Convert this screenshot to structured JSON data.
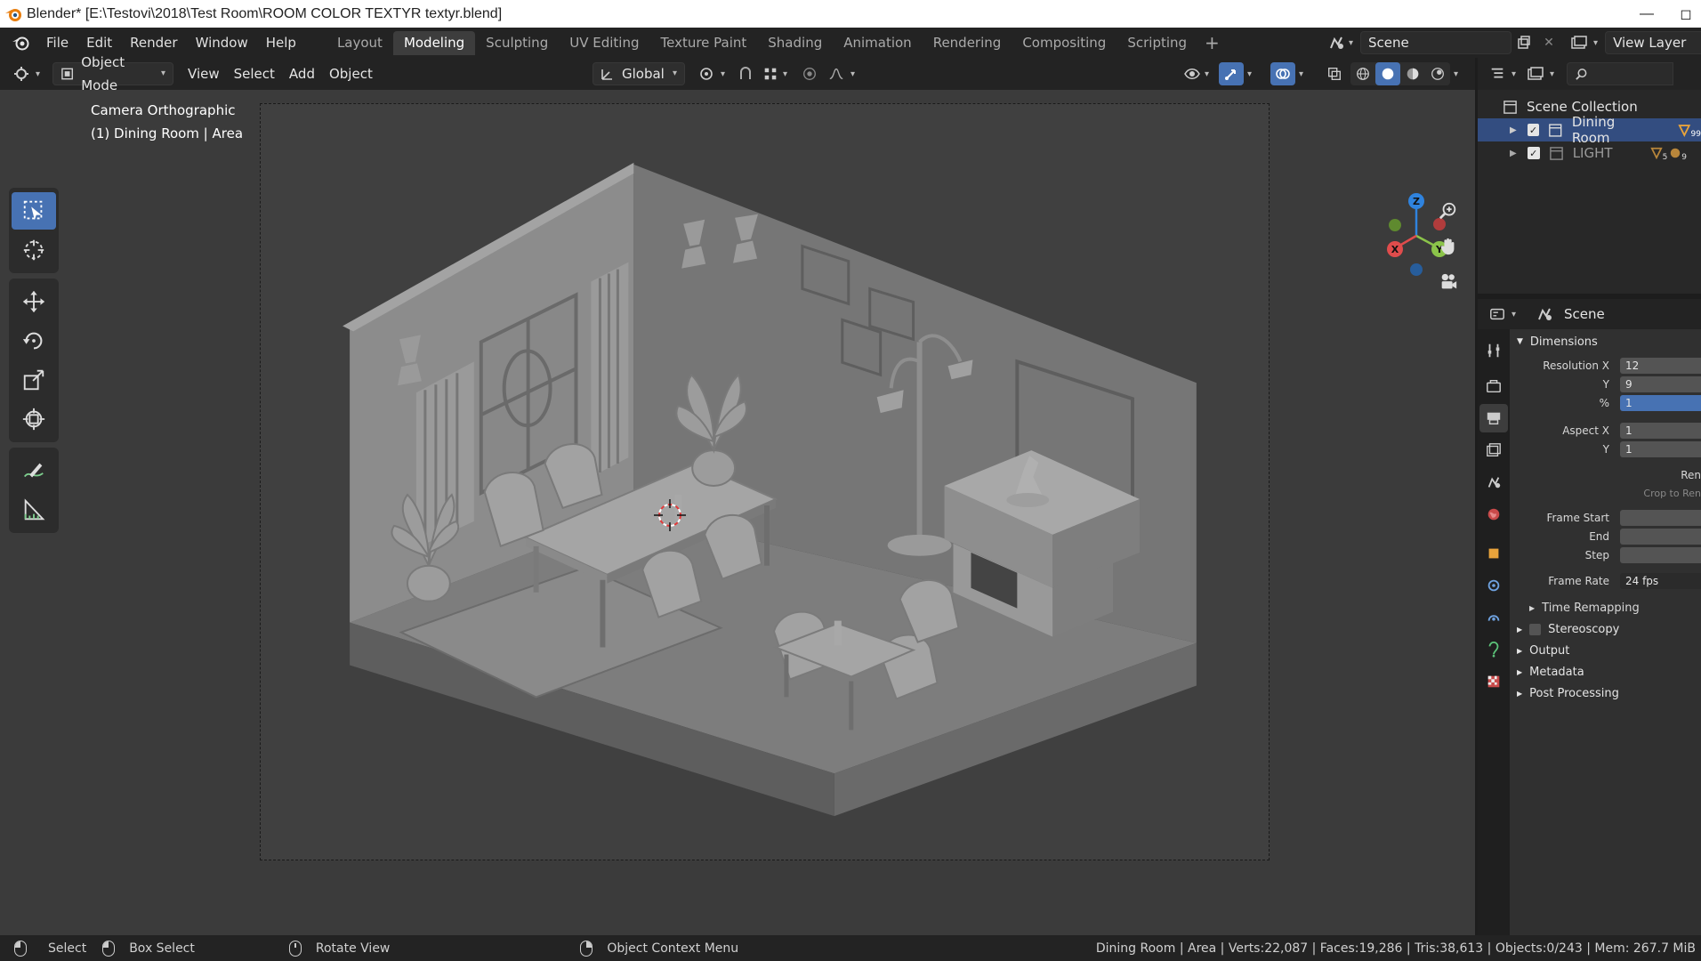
{
  "window": {
    "title": "Blender* [E:\\Testovi\\2018\\Test Room\\ROOM COLOR TEXTYR textyr.blend]",
    "controls": [
      "—",
      "◻"
    ]
  },
  "menu": [
    "File",
    "Edit",
    "Render",
    "Window",
    "Help"
  ],
  "workspaces": [
    {
      "label": "Layout",
      "active": false
    },
    {
      "label": "Modeling",
      "active": true
    },
    {
      "label": "Sculpting",
      "active": false
    },
    {
      "label": "UV Editing",
      "active": false
    },
    {
      "label": "Texture Paint",
      "active": false
    },
    {
      "label": "Shading",
      "active": false
    },
    {
      "label": "Animation",
      "active": false
    },
    {
      "label": "Rendering",
      "active": false
    },
    {
      "label": "Compositing",
      "active": false
    },
    {
      "label": "Scripting",
      "active": false
    }
  ],
  "workspace_add": "+",
  "scene_field": "Scene",
  "view_layer_field": "View Layer",
  "header": {
    "mode": "Object Mode",
    "view": "View",
    "select": "Select",
    "add": "Add",
    "object": "Object",
    "orientation": "Global"
  },
  "viewport": {
    "camera_label": "Camera Orthographic",
    "object_label": "(1) Dining Room | Area"
  },
  "gizmo": {
    "z": "Z",
    "y": "Y",
    "x": "X"
  },
  "outliner": {
    "root": "Scene Collection",
    "items": [
      {
        "label": "Dining Room",
        "selected": true,
        "badge": "99"
      },
      {
        "label": "LIGHT",
        "selected": false,
        "badge1": "5",
        "badge2": "9"
      }
    ]
  },
  "properties": {
    "context": "Scene",
    "dimensions_label": "Dimensions",
    "rows": [
      {
        "label": "Resolution X",
        "value": "12"
      },
      {
        "label": "Y",
        "value": "9"
      },
      {
        "label": "%",
        "value": "1"
      },
      {
        "label": "Aspect X",
        "value": "1"
      },
      {
        "label": "Y",
        "value": "1"
      }
    ],
    "render_region": "Ren",
    "crop": "Crop to Ren",
    "frame_rows": [
      {
        "label": "Frame Start",
        "value": ""
      },
      {
        "label": "End",
        "value": ""
      },
      {
        "label": "Step",
        "value": ""
      }
    ],
    "frame_rate_label": "Frame Rate",
    "frame_rate_value": "24 fps",
    "time_remapping": "Time Remapping",
    "stereoscopy": "Stereoscopy",
    "output": "Output",
    "metadata": "Metadata",
    "post_processing": "Post Processing"
  },
  "statusbar": {
    "select": "Select",
    "box_select": "Box Select",
    "rotate_view": "Rotate View",
    "context_menu": "Object Context Menu",
    "stats": "Dining Room | Area | Verts:22,087 | Faces:19,286 | Tris:38,613 | Objects:0/243 | Mem: 267.7 MiB"
  }
}
